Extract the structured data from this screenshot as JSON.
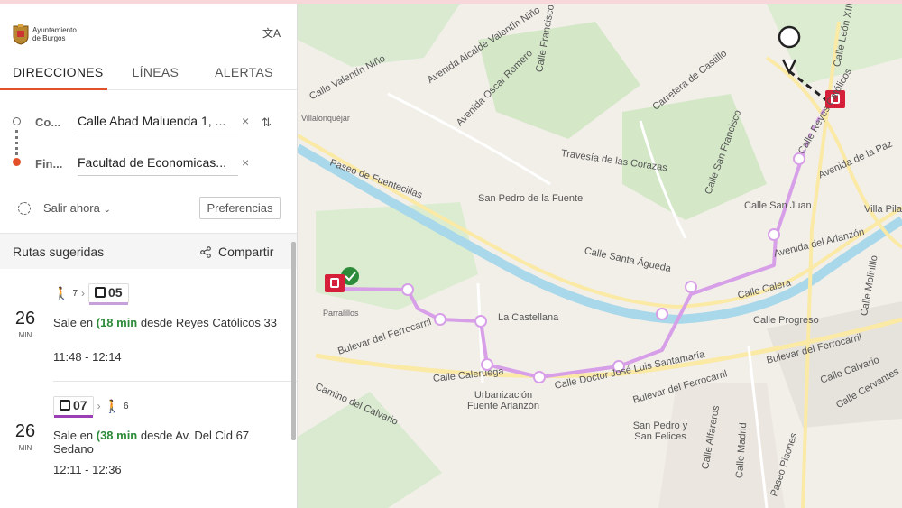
{
  "header": {
    "logo_text_line1": "Ayuntamiento",
    "logo_text_line2": "de Burgos",
    "translate_icon": "translate-icon"
  },
  "tabs": [
    {
      "label": "DIRECCIONES",
      "active": true
    },
    {
      "label": "LÍNEAS",
      "active": false
    },
    {
      "label": "ALERTAS",
      "active": false
    }
  ],
  "form": {
    "origin_label": "Co...",
    "origin_value": "Calle Abad Maluenda 1, ...",
    "destination_label": "Fin...",
    "destination_value": "Facultad de Economicas...",
    "clear_glyph": "×",
    "swap_glyph": "⇅"
  },
  "depart": {
    "label": "Salir ahora",
    "preferences_label": "Preferencias"
  },
  "suggested": {
    "title": "Rutas sugeridas",
    "share_label": "Compartir"
  },
  "routes": [
    {
      "duration": "26",
      "unit": "MIN",
      "walk_before": "7",
      "bus_line": "05",
      "walk_after": "",
      "depart_prefix": "Sale en",
      "depart_time": "18 min",
      "depart_from": "desde Reyes Católicos",
      "stop_suffix": "33",
      "time_range": "11:48 - 12:14"
    },
    {
      "duration": "26",
      "unit": "MIN",
      "walk_before": "",
      "bus_line": "07",
      "walk_after": "6",
      "depart_prefix": "Sale en",
      "depart_time": "38 min",
      "depart_from": "desde Av. Del Cid 67",
      "stop_suffix": "Sedano",
      "time_range": "12:11 - 12:36"
    }
  ],
  "map": {
    "labels": {
      "l1": "Avenida Alcalde Valentín Niño",
      "l2": "Calle Francisco Salinas",
      "l3": "Calle Valentín Niño",
      "l4": "Avenida Oscar Romero",
      "l5": "Carretera de Castillo",
      "l6": "Calle San Francisco",
      "l7": "Calle León XIII",
      "l8": "Villalonquéjar",
      "l9": "Paseo de Fuentecillas",
      "l10": "San Pedro de la Fuente",
      "l11": "Travesía de las Corazas",
      "l12": "Calle San Juan",
      "l13": "Avenida del Arlanzón",
      "l14": "Calle Santa Águeda",
      "l15": "Calle Calera",
      "l16": "La Castellana",
      "l17": "Calle Progreso",
      "l18": "Bulevar del Ferrocarril",
      "l19": "Calle Doctor José Luis Santamaría",
      "l20": "Calle Caleruega",
      "l21": "Urbanización Fuente Arlanzón",
      "l22": "Camino del Calvario",
      "l23": "San Pedro y San Felices",
      "l24": "Calle Alfareros",
      "l25": "Calle Madrid",
      "l26": "Calle Calvario",
      "l27": "Calle Cervantes",
      "l28": "Avenida de la Paz",
      "l29": "Parralillos",
      "l30": "Villa Pilar",
      "l31": "Calle Molinillo",
      "l32": "Paseo Pisones",
      "l33": "Calle Reyes Católicos"
    }
  }
}
